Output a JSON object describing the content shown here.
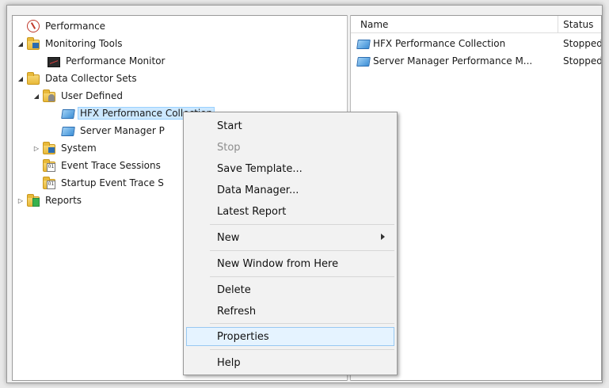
{
  "tree": {
    "root": {
      "label": "Performance",
      "icon": "performance-icon"
    },
    "monitoring_tools": {
      "label": "Monitoring Tools",
      "icon": "tools-folder-icon"
    },
    "performance_monitor": {
      "label": "Performance Monitor",
      "icon": "monitor-icon"
    },
    "data_collector_sets": {
      "label": "Data Collector Sets",
      "icon": "folder-icon"
    },
    "user_defined": {
      "label": "User Defined",
      "icon": "user-folder-icon"
    },
    "hfx": {
      "label": "HFX Performance Collection",
      "icon": "data-collector-icon"
    },
    "server_manager": {
      "label": "Server Manager P",
      "icon": "data-collector-icon"
    },
    "system": {
      "label": "System",
      "icon": "folder-icon"
    },
    "event_trace": {
      "label": "Event Trace Sessions",
      "icon": "log-folder-icon"
    },
    "startup_event": {
      "label": "Startup Event Trace S",
      "icon": "log-folder-icon"
    },
    "reports": {
      "label": "Reports",
      "icon": "reports-folder-icon"
    }
  },
  "list": {
    "columns": {
      "name": "Name",
      "status": "Status"
    },
    "rows": [
      {
        "name": "HFX Performance Collection",
        "status": "Stopped"
      },
      {
        "name": "Server Manager Performance M...",
        "status": "Stopped"
      }
    ]
  },
  "context_menu": {
    "start": "Start",
    "stop": "Stop",
    "save_template": "Save Template...",
    "data_manager": "Data Manager...",
    "latest_report": "Latest Report",
    "new": "New",
    "new_window": "New Window from Here",
    "delete": "Delete",
    "refresh": "Refresh",
    "properties": "Properties",
    "help": "Help"
  },
  "colors": {
    "selection": "#cce8ff",
    "menu_hover": "#e5f3ff",
    "menu_hover_border": "#98c8f2",
    "disabled_text": "#8d8d8d"
  }
}
